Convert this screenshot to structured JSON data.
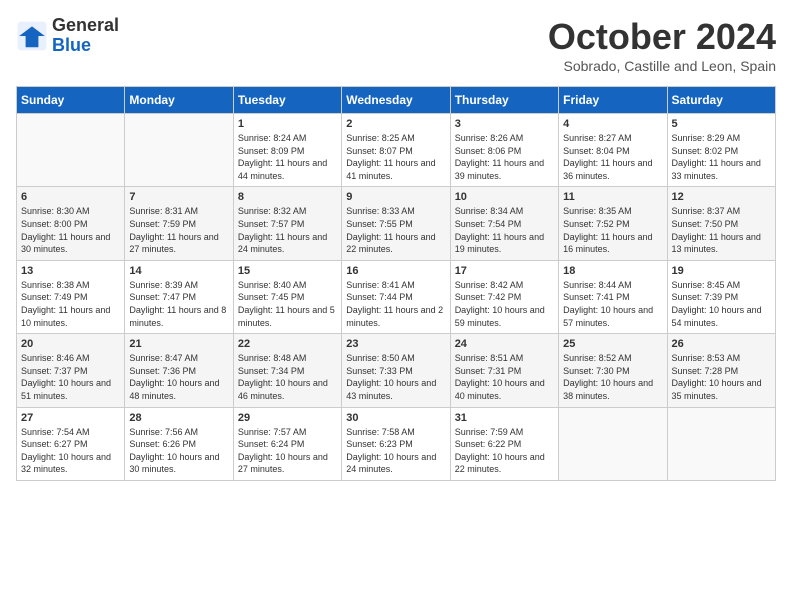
{
  "header": {
    "logo_line1": "General",
    "logo_line2": "Blue",
    "month": "October 2024",
    "location": "Sobrado, Castille and Leon, Spain"
  },
  "days_of_week": [
    "Sunday",
    "Monday",
    "Tuesday",
    "Wednesday",
    "Thursday",
    "Friday",
    "Saturday"
  ],
  "weeks": [
    [
      {
        "day": "",
        "info": ""
      },
      {
        "day": "",
        "info": ""
      },
      {
        "day": "1",
        "info": "Sunrise: 8:24 AM\nSunset: 8:09 PM\nDaylight: 11 hours and 44 minutes."
      },
      {
        "day": "2",
        "info": "Sunrise: 8:25 AM\nSunset: 8:07 PM\nDaylight: 11 hours and 41 minutes."
      },
      {
        "day": "3",
        "info": "Sunrise: 8:26 AM\nSunset: 8:06 PM\nDaylight: 11 hours and 39 minutes."
      },
      {
        "day": "4",
        "info": "Sunrise: 8:27 AM\nSunset: 8:04 PM\nDaylight: 11 hours and 36 minutes."
      },
      {
        "day": "5",
        "info": "Sunrise: 8:29 AM\nSunset: 8:02 PM\nDaylight: 11 hours and 33 minutes."
      }
    ],
    [
      {
        "day": "6",
        "info": "Sunrise: 8:30 AM\nSunset: 8:00 PM\nDaylight: 11 hours and 30 minutes."
      },
      {
        "day": "7",
        "info": "Sunrise: 8:31 AM\nSunset: 7:59 PM\nDaylight: 11 hours and 27 minutes."
      },
      {
        "day": "8",
        "info": "Sunrise: 8:32 AM\nSunset: 7:57 PM\nDaylight: 11 hours and 24 minutes."
      },
      {
        "day": "9",
        "info": "Sunrise: 8:33 AM\nSunset: 7:55 PM\nDaylight: 11 hours and 22 minutes."
      },
      {
        "day": "10",
        "info": "Sunrise: 8:34 AM\nSunset: 7:54 PM\nDaylight: 11 hours and 19 minutes."
      },
      {
        "day": "11",
        "info": "Sunrise: 8:35 AM\nSunset: 7:52 PM\nDaylight: 11 hours and 16 minutes."
      },
      {
        "day": "12",
        "info": "Sunrise: 8:37 AM\nSunset: 7:50 PM\nDaylight: 11 hours and 13 minutes."
      }
    ],
    [
      {
        "day": "13",
        "info": "Sunrise: 8:38 AM\nSunset: 7:49 PM\nDaylight: 11 hours and 10 minutes."
      },
      {
        "day": "14",
        "info": "Sunrise: 8:39 AM\nSunset: 7:47 PM\nDaylight: 11 hours and 8 minutes."
      },
      {
        "day": "15",
        "info": "Sunrise: 8:40 AM\nSunset: 7:45 PM\nDaylight: 11 hours and 5 minutes."
      },
      {
        "day": "16",
        "info": "Sunrise: 8:41 AM\nSunset: 7:44 PM\nDaylight: 11 hours and 2 minutes."
      },
      {
        "day": "17",
        "info": "Sunrise: 8:42 AM\nSunset: 7:42 PM\nDaylight: 10 hours and 59 minutes."
      },
      {
        "day": "18",
        "info": "Sunrise: 8:44 AM\nSunset: 7:41 PM\nDaylight: 10 hours and 57 minutes."
      },
      {
        "day": "19",
        "info": "Sunrise: 8:45 AM\nSunset: 7:39 PM\nDaylight: 10 hours and 54 minutes."
      }
    ],
    [
      {
        "day": "20",
        "info": "Sunrise: 8:46 AM\nSunset: 7:37 PM\nDaylight: 10 hours and 51 minutes."
      },
      {
        "day": "21",
        "info": "Sunrise: 8:47 AM\nSunset: 7:36 PM\nDaylight: 10 hours and 48 minutes."
      },
      {
        "day": "22",
        "info": "Sunrise: 8:48 AM\nSunset: 7:34 PM\nDaylight: 10 hours and 46 minutes."
      },
      {
        "day": "23",
        "info": "Sunrise: 8:50 AM\nSunset: 7:33 PM\nDaylight: 10 hours and 43 minutes."
      },
      {
        "day": "24",
        "info": "Sunrise: 8:51 AM\nSunset: 7:31 PM\nDaylight: 10 hours and 40 minutes."
      },
      {
        "day": "25",
        "info": "Sunrise: 8:52 AM\nSunset: 7:30 PM\nDaylight: 10 hours and 38 minutes."
      },
      {
        "day": "26",
        "info": "Sunrise: 8:53 AM\nSunset: 7:28 PM\nDaylight: 10 hours and 35 minutes."
      }
    ],
    [
      {
        "day": "27",
        "info": "Sunrise: 7:54 AM\nSunset: 6:27 PM\nDaylight: 10 hours and 32 minutes."
      },
      {
        "day": "28",
        "info": "Sunrise: 7:56 AM\nSunset: 6:26 PM\nDaylight: 10 hours and 30 minutes."
      },
      {
        "day": "29",
        "info": "Sunrise: 7:57 AM\nSunset: 6:24 PM\nDaylight: 10 hours and 27 minutes."
      },
      {
        "day": "30",
        "info": "Sunrise: 7:58 AM\nSunset: 6:23 PM\nDaylight: 10 hours and 24 minutes."
      },
      {
        "day": "31",
        "info": "Sunrise: 7:59 AM\nSunset: 6:22 PM\nDaylight: 10 hours and 22 minutes."
      },
      {
        "day": "",
        "info": ""
      },
      {
        "day": "",
        "info": ""
      }
    ]
  ]
}
